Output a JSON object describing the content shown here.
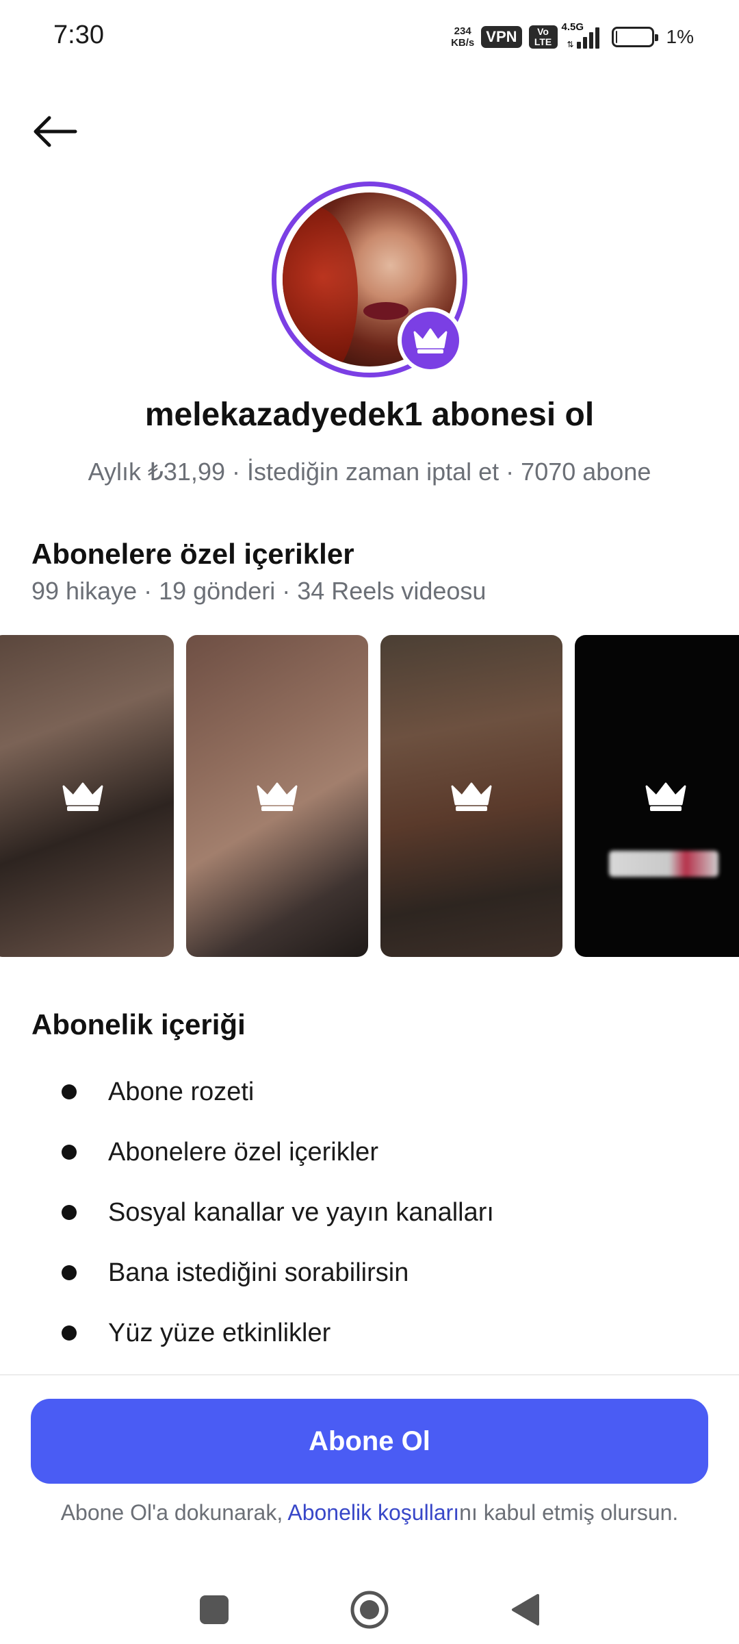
{
  "status_bar": {
    "time": "7:30",
    "net_speed_value": "234",
    "net_speed_unit": "KB/s",
    "vpn": "VPN",
    "volte_top": "Vo",
    "volte_bottom": "LTE",
    "network": "4.5G",
    "battery_percent": "1%",
    "battery_level": 0.01
  },
  "header": {
    "back_icon": "arrow-left-icon"
  },
  "profile": {
    "badge_icon": "crown-icon",
    "title": "melekazadyedek1 abonesi ol",
    "subtitle": "Aylık ₺31,99 · İstediğin zaman iptal et · 7070 abone"
  },
  "exclusive": {
    "title": "Abonelere özel içerikler",
    "subtitle": "99 hikaye · 19 gönderi · 34 Reels videosu",
    "thumb_icon": "crown-icon"
  },
  "benefits": {
    "title": "Abonelik içeriği",
    "items": [
      "Abone rozeti",
      "Abonelere özel içerikler",
      "Sosyal kanallar ve yayın kanalları",
      "Bana istediğini sorabilirsin",
      "Yüz yüze etkinlikler"
    ]
  },
  "footer": {
    "button_label": "Abone Ol",
    "terms_prefix": "Abone Ol'a dokunarak, ",
    "terms_link": "Abonelik koşulları",
    "terms_suffix": "nı kabul etmiş olursun.",
    "accent_color": "#4a5cf4"
  },
  "nav": {
    "recent_icon": "square-recents-icon",
    "home_icon": "circle-home-icon",
    "back_icon": "triangle-back-icon"
  }
}
